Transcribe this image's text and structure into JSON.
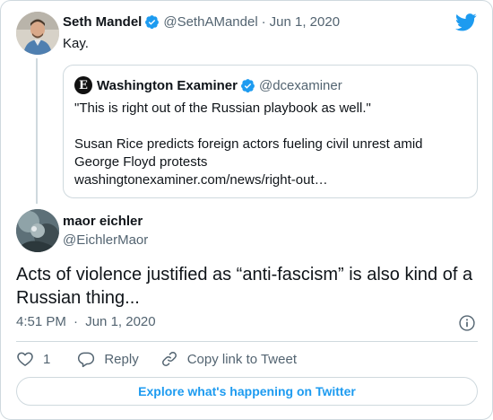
{
  "parent": {
    "name": "Seth Mandel",
    "handle": "@SethAMandel",
    "separator": "·",
    "date": "Jun 1, 2020",
    "text": "Kay."
  },
  "quoted": {
    "logo_letter": "E",
    "name": "Washington Examiner",
    "handle": "@dcexaminer",
    "line1": "\"This is right out of the Russian playbook as well.\"",
    "line2": "Susan Rice predicts foreign actors fueling civil unrest amid",
    "line3": "George Floyd protests",
    "link": "washingtonexaminer.com/news/right-out…"
  },
  "tweet": {
    "name": "maor eichler",
    "handle": "@EichlerMaor",
    "text": "Acts of violence justified as “anti-fascism” is also kind of a Russian thing...",
    "time": "4:51 PM",
    "separator": "·",
    "date": "Jun 1, 2020"
  },
  "actions": {
    "like_count": "1",
    "reply_label": "Reply",
    "copy_label": "Copy link to Tweet"
  },
  "explore_label": "Explore what's happening on Twitter",
  "colors": {
    "accent": "#1d9bf0",
    "text": "#0f1419",
    "muted": "#536471",
    "border": "#cfd9de"
  },
  "icons": {
    "brand": "twitter-bird-icon",
    "verified": "verified-badge-icon",
    "info": "info-icon",
    "like": "heart-icon",
    "reply": "reply-bubble-icon",
    "copy": "link-icon"
  }
}
